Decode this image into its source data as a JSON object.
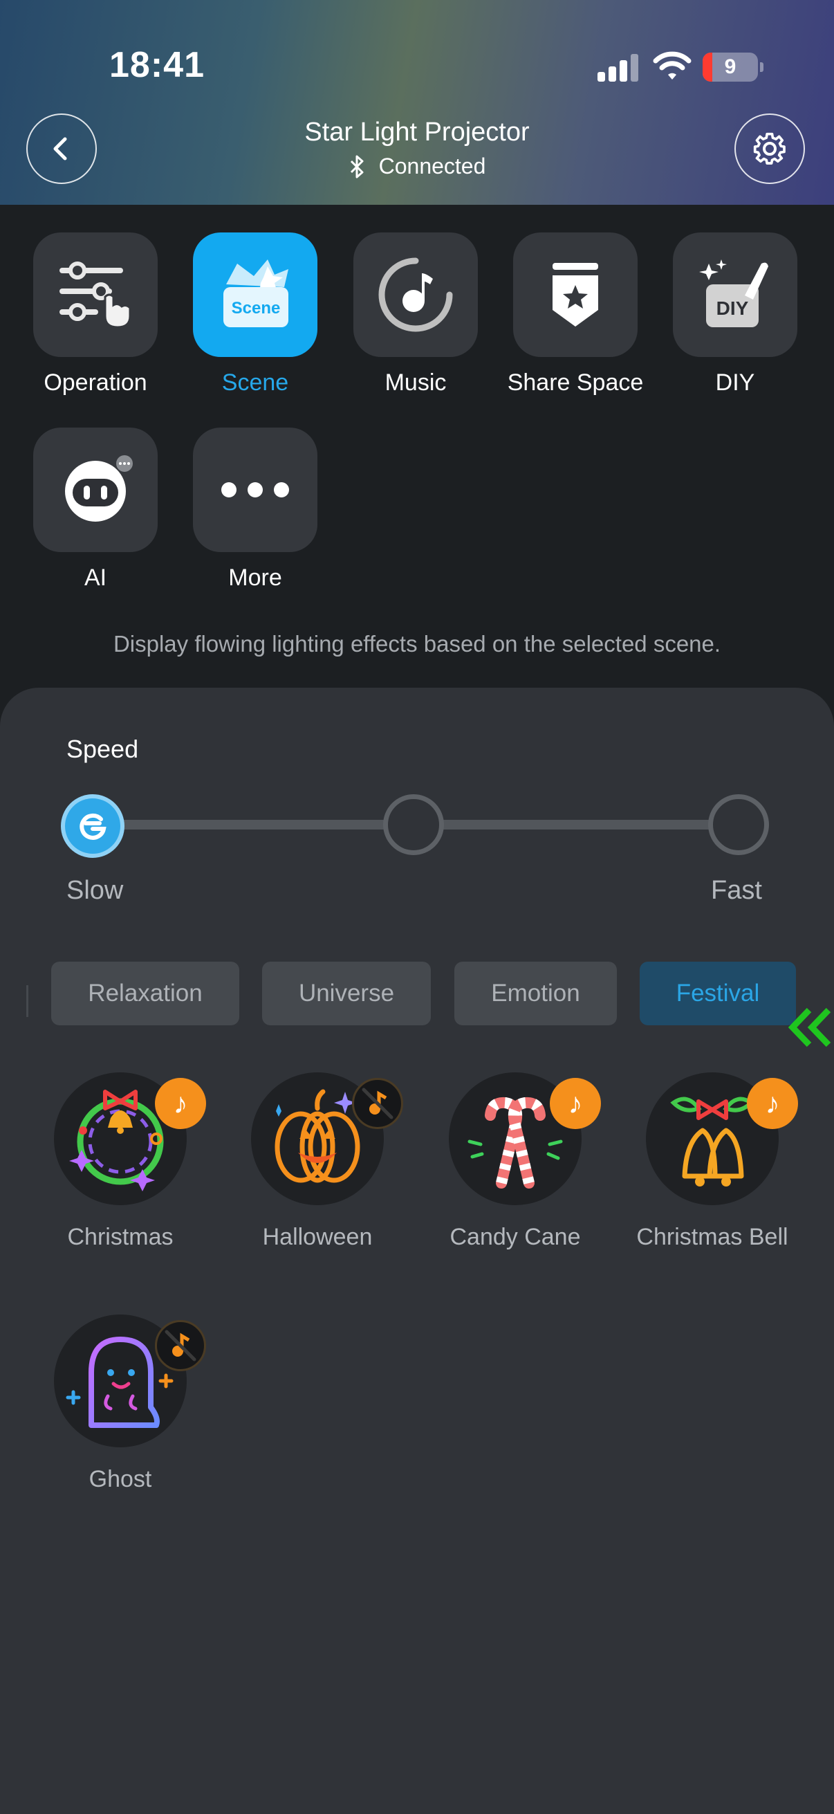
{
  "status_bar": {
    "time": "18:41",
    "battery": "9"
  },
  "header": {
    "title": "Star Light Projector",
    "connection": "Connected"
  },
  "features": [
    {
      "label": "Operation",
      "icon": "sliders-icon",
      "active": false
    },
    {
      "label": "Scene",
      "icon": "scene-icon",
      "active": true
    },
    {
      "label": "Music",
      "icon": "music-note-icon",
      "active": false
    },
    {
      "label": "Share Space",
      "icon": "share-space-icon",
      "active": false
    },
    {
      "label": "DIY",
      "icon": "diy-icon",
      "active": false
    },
    {
      "label": "AI",
      "icon": "robot-face-icon",
      "active": false
    },
    {
      "label": "More",
      "icon": "more-dots-icon",
      "active": false
    }
  ],
  "description": "Display flowing lighting effects based on the selected scene.",
  "speed": {
    "label": "Speed",
    "slow_label": "Slow",
    "fast_label": "Fast",
    "level": 0,
    "steps": 3
  },
  "tabs": [
    {
      "label": "Relaxation",
      "active": false
    },
    {
      "label": "Universe",
      "active": false
    },
    {
      "label": "Emotion",
      "active": false
    },
    {
      "label": "Festival",
      "active": true
    }
  ],
  "scenes": [
    {
      "name": "Christmas",
      "icon": "christmas-wreath-icon",
      "music": true
    },
    {
      "name": "Halloween",
      "icon": "pumpkin-icon",
      "music": false
    },
    {
      "name": "Candy Cane",
      "icon": "candy-cane-icon",
      "music": true
    },
    {
      "name": "Christmas Bell",
      "icon": "christmas-bell-icon",
      "music": true
    },
    {
      "name": "Ghost",
      "icon": "ghost-icon",
      "music": false
    }
  ],
  "colors": {
    "accent": "#13a9f0",
    "music_badge": "#f5901c",
    "annotation": "#1fc51f"
  }
}
